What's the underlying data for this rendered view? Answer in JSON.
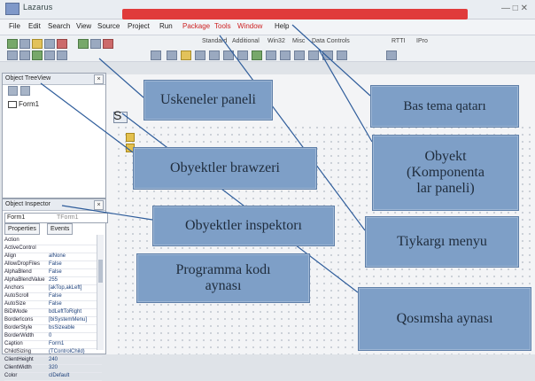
{
  "app": {
    "title": "Lazarus",
    "window_controls": "— □ ✕"
  },
  "menu": {
    "items": [
      "File",
      "Edit",
      "Search",
      "View",
      "Source",
      "Project",
      "Run"
    ],
    "highlighted": [
      "Package",
      "Tools",
      "Window"
    ],
    "extra": [
      "Help"
    ]
  },
  "toolbar": {
    "labels": [
      "Standard",
      "Additional",
      "Win32",
      "Misc",
      "Data Controls"
    ],
    "right_labels": [
      "RTTI",
      "IPro"
    ]
  },
  "treeview": {
    "title": "Object TreeView",
    "close": "×",
    "node": "Form1"
  },
  "inspector": {
    "title": "Object Inspector",
    "close": "×",
    "combo_left": "Form1",
    "combo_value": "TForm1",
    "tabs": [
      "Properties",
      "Events"
    ],
    "properties": [
      {
        "name": "Action",
        "value": ""
      },
      {
        "name": "ActiveControl",
        "value": ""
      },
      {
        "name": "Align",
        "value": "alNone"
      },
      {
        "name": "AllowDropFiles",
        "value": "False"
      },
      {
        "name": "AlphaBlend",
        "value": "False"
      },
      {
        "name": "AlphaBlendValue",
        "value": "255"
      },
      {
        "name": "Anchors",
        "value": "[akTop,akLeft]"
      },
      {
        "name": "AutoScroll",
        "value": "False"
      },
      {
        "name": "AutoSize",
        "value": "False"
      },
      {
        "name": "BiDiMode",
        "value": "bdLeftToRight"
      },
      {
        "name": "BorderIcons",
        "value": "[biSystemMenu]"
      },
      {
        "name": "BorderStyle",
        "value": "bsSizeable"
      },
      {
        "name": "BorderWidth",
        "value": "0"
      },
      {
        "name": "Caption",
        "value": "Form1"
      },
      {
        "name": "ChildSizing",
        "value": "(TControlChild)"
      },
      {
        "name": "ClientHeight",
        "value": "240"
      },
      {
        "name": "ClientWidth",
        "value": "320"
      },
      {
        "name": "Color",
        "value": "clDefault"
      }
    ]
  },
  "designer": {
    "tab_char": "S"
  },
  "callouts": {
    "uskeneler": "Uskeneler paneli",
    "bas_tema": "Bas tema qatarı",
    "obyekt_komponenta": "Obyekt\n(Komponenta\nlar paneli)",
    "obyektler_brawzeri": "Obyektler brawzeri",
    "obyektler_inspektori": "Obyektler inspektorı",
    "tiykargi_menyu": "Tiykargı menyu",
    "programma_kodi": "Programma kodı\naynası",
    "qosimsha_aynasi": "Qosımsha aynası"
  },
  "colors": {
    "callout_fill": "#7e9fc7",
    "callout_border": "#5f7fa8",
    "pointer_line": "#2f5d9b",
    "accent_red": "#e03b3b"
  }
}
